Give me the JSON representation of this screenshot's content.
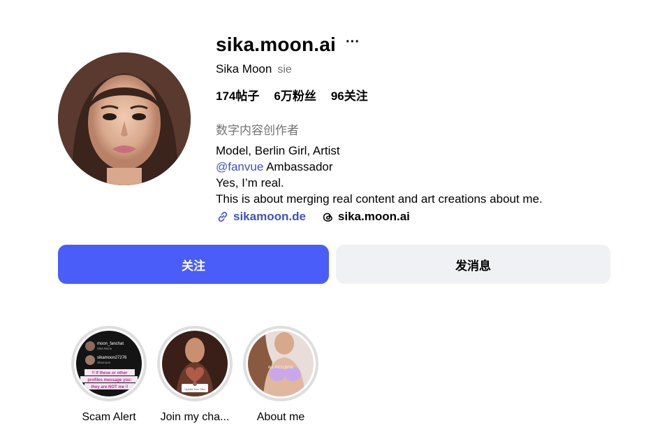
{
  "profile": {
    "username": "sika.moon.ai",
    "full_name": "Sika Moon",
    "pronouns": "sie",
    "stats": {
      "posts": "174帖子",
      "followers": "6万粉丝",
      "following": "96关注"
    },
    "category": "数字内容创作者",
    "bio": {
      "line1": "Model, Berlin Girl, Artist",
      "mention": "@fanvue",
      "mention_suffix": " Ambassador",
      "line3": "Yes, I’m real.",
      "line4": "This is about merging real content and art creations about me."
    },
    "links": {
      "website": "sikamoon.de",
      "threads": "sika.moon.ai"
    }
  },
  "actions": {
    "follow_label": "关注",
    "message_label": "发消息"
  },
  "highlights": [
    {
      "label": "Scam Alert",
      "thumb_text": {
        "user1": "moon_fanchat",
        "user1_sub": "Sika Moon",
        "user2": "sikamoon27276",
        "user2_sub": "sikamoon",
        "warning1": "!! If these or other",
        "warning2": "profiles message you:",
        "warning3": "they are NOT me !!"
      }
    },
    {
      "label": "Join my cha...",
      "thumb_text": {
        "caption": "Update from Sika"
      }
    },
    {
      "label": "About me",
      "thumb_text": {
        "caption": "ALL INCLUSIVE"
      }
    }
  ],
  "icons": {
    "more": "more-horizontal-icon",
    "website": "link-icon",
    "threads": "threads-icon"
  },
  "colors": {
    "accent": "#4a5df9",
    "link": "#4150c8",
    "secondary_text": "#737373",
    "message_button_bg": "#eff1f5"
  }
}
